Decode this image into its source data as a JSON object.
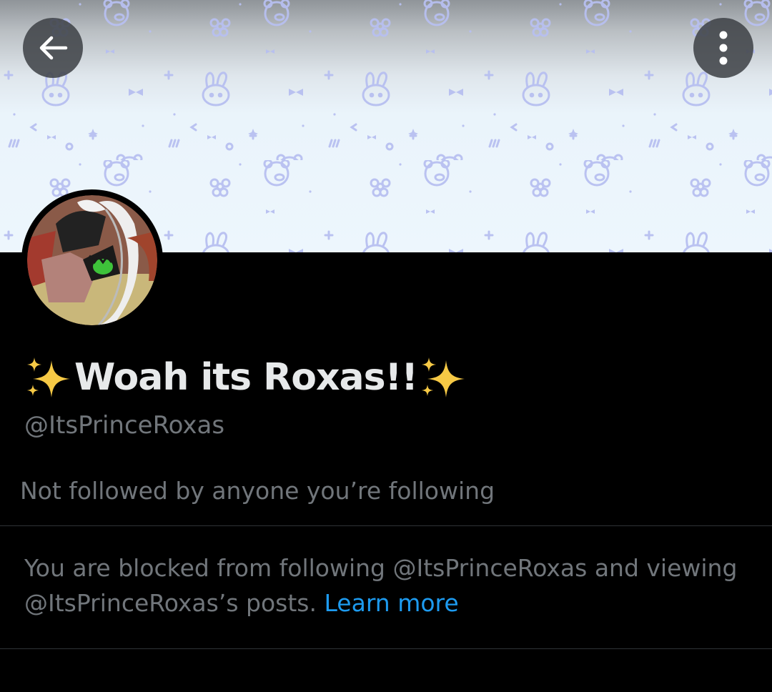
{
  "header": {
    "back_icon": "arrow-left-icon",
    "more_icon": "vertical-dots-icon"
  },
  "banner": {
    "pattern_color": "#b7bff0"
  },
  "profile": {
    "display_name": "Woah its Roxas!!",
    "name_emoji": "sparkles",
    "handle": "@ItsPrinceRoxas",
    "followed_by": "Not followed by anyone you’re following"
  },
  "blocked_notice": {
    "text": "You are blocked from following @ItsPrinceRoxas and viewing @ItsPrinceRoxas’s posts.",
    "link_label": "Learn more"
  },
  "colors": {
    "background": "#000000",
    "primary_text": "#e7e9ea",
    "secondary_text": "#71767b",
    "link": "#1d9bf0",
    "divider": "#2f3336"
  }
}
